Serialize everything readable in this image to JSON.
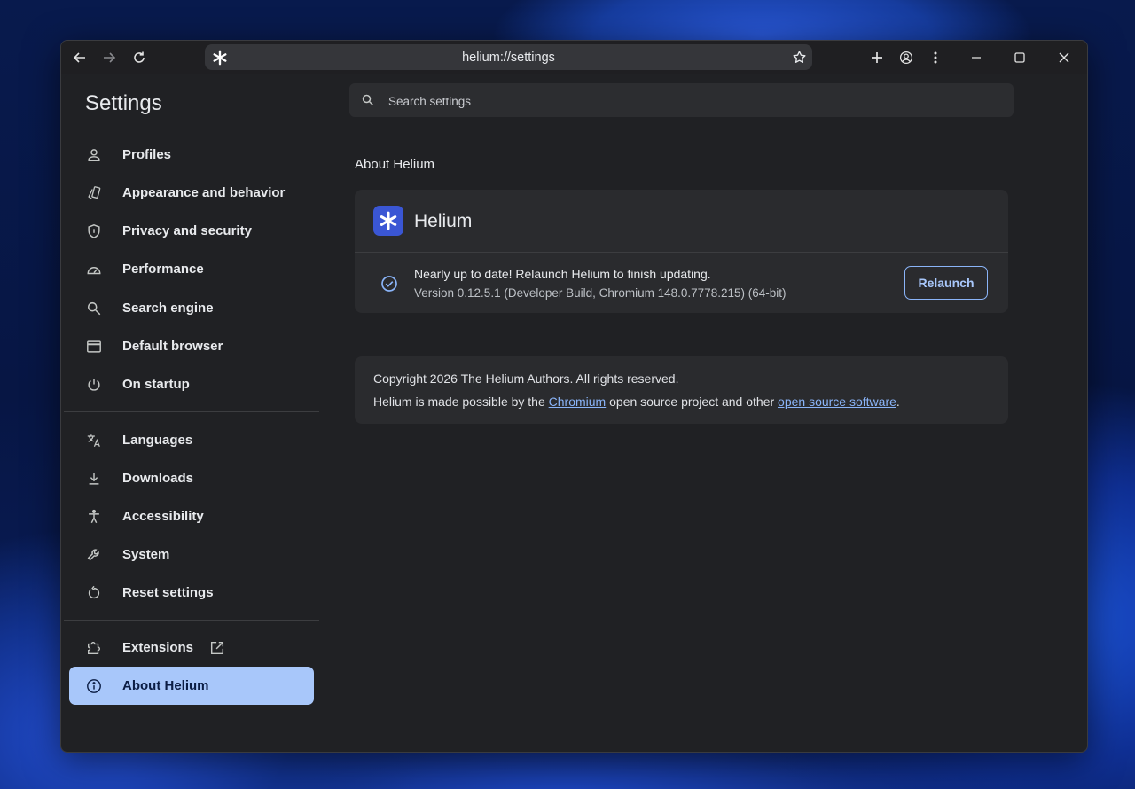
{
  "browser": {
    "url": "helium://settings",
    "back_icon": "arrow-left-icon",
    "forward_icon": "arrow-right-icon",
    "reload_icon": "reload-icon",
    "new_tab_icon": "plus-icon",
    "profile_icon": "account-circle-icon",
    "menu_icon": "kebab-menu-icon"
  },
  "sidebar": {
    "title": "Settings",
    "items": [
      {
        "label": "Profiles",
        "icon": "person-icon"
      },
      {
        "label": "Appearance and behavior",
        "icon": "palette-icon"
      },
      {
        "label": "Privacy and security",
        "icon": "shield-icon"
      },
      {
        "label": "Performance",
        "icon": "speedometer-icon"
      },
      {
        "label": "Search engine",
        "icon": "search-icon"
      },
      {
        "label": "Default browser",
        "icon": "browser-window-icon"
      },
      {
        "label": "On startup",
        "icon": "power-icon"
      },
      {
        "label": "Languages",
        "icon": "translate-icon"
      },
      {
        "label": "Downloads",
        "icon": "download-icon"
      },
      {
        "label": "Accessibility",
        "icon": "accessibility-icon"
      },
      {
        "label": "System",
        "icon": "wrench-icon"
      },
      {
        "label": "Reset settings",
        "icon": "reset-icon"
      },
      {
        "label": "Extensions",
        "icon": "puzzle-icon"
      },
      {
        "label": "About Helium",
        "icon": "info-icon",
        "active": true
      }
    ]
  },
  "search": {
    "placeholder": "Search settings"
  },
  "about": {
    "section_title": "About Helium",
    "app_name": "Helium",
    "status": "Nearly up to date! Relaunch Helium to finish updating.",
    "version": "Version 0.12.5.1 (Developer Build, Chromium 148.0.7778.215) (64-bit)",
    "relaunch_label": "Relaunch",
    "copyright": "Copyright 2026 The Helium Authors. All rights reserved.",
    "made_prefix": "Helium is made possible by the ",
    "chromium_link": "Chromium",
    "made_middle": " open source project and other ",
    "oss_link": "open source software",
    "made_suffix": "."
  },
  "colors": {
    "accent": "#a8c7fa",
    "link": "#8ab4f8",
    "background": "#202124",
    "logo": "#3a56d4"
  }
}
